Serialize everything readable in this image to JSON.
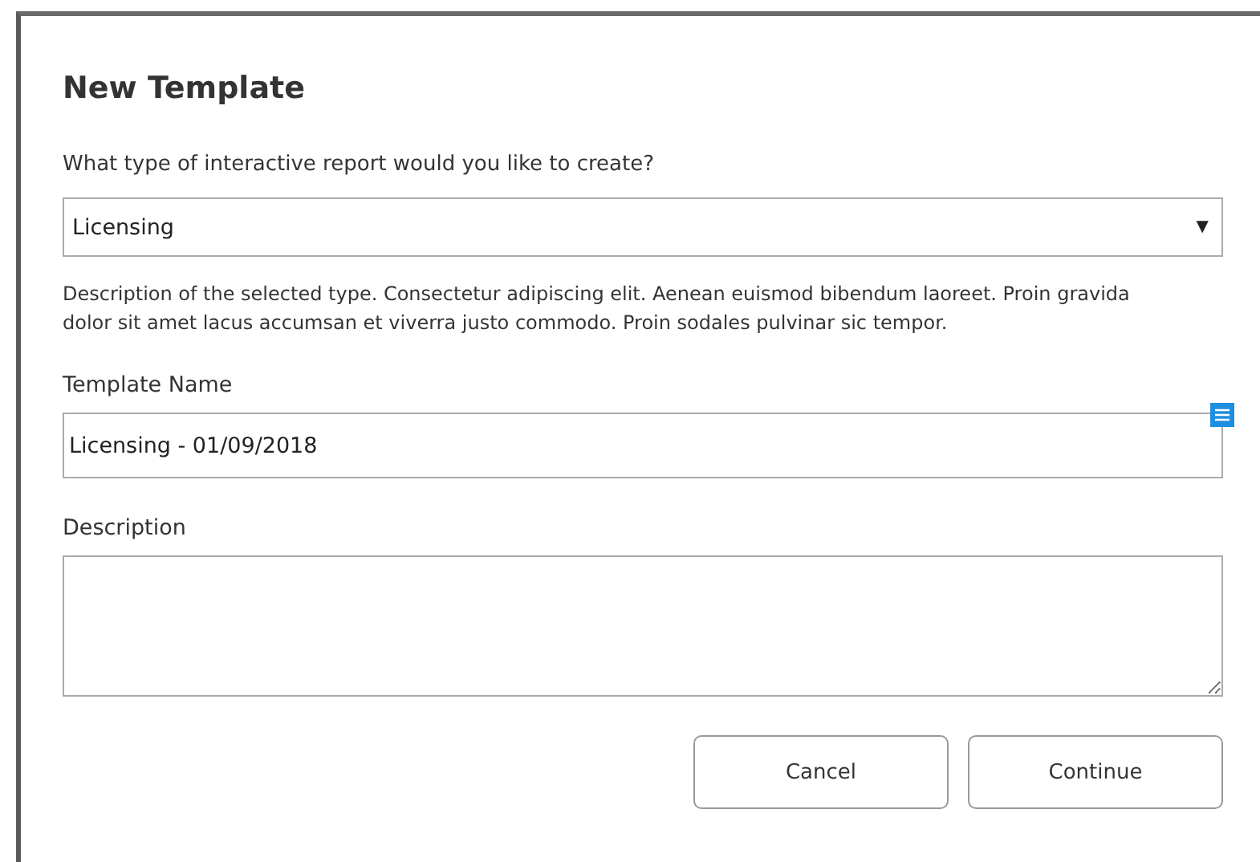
{
  "dialog": {
    "title": "New Template",
    "type_question": "What type of interactive report would you like to create?",
    "type_select": {
      "value": "Licensing",
      "caret": "▼"
    },
    "type_description": "Description of the selected type.  Consectetur adipiscing elit. Aenean euismod bibendum laoreet. Proin gravida dolor sit amet lacus accumsan et viverra justo commodo. Proin sodales pulvinar sic tempor.",
    "name_label": "Template Name",
    "name_field": {
      "value": "Licensing - 01/09/2018"
    },
    "description_label": "Description",
    "buttons": [
      "Cancel",
      "Continue"
    ]
  }
}
